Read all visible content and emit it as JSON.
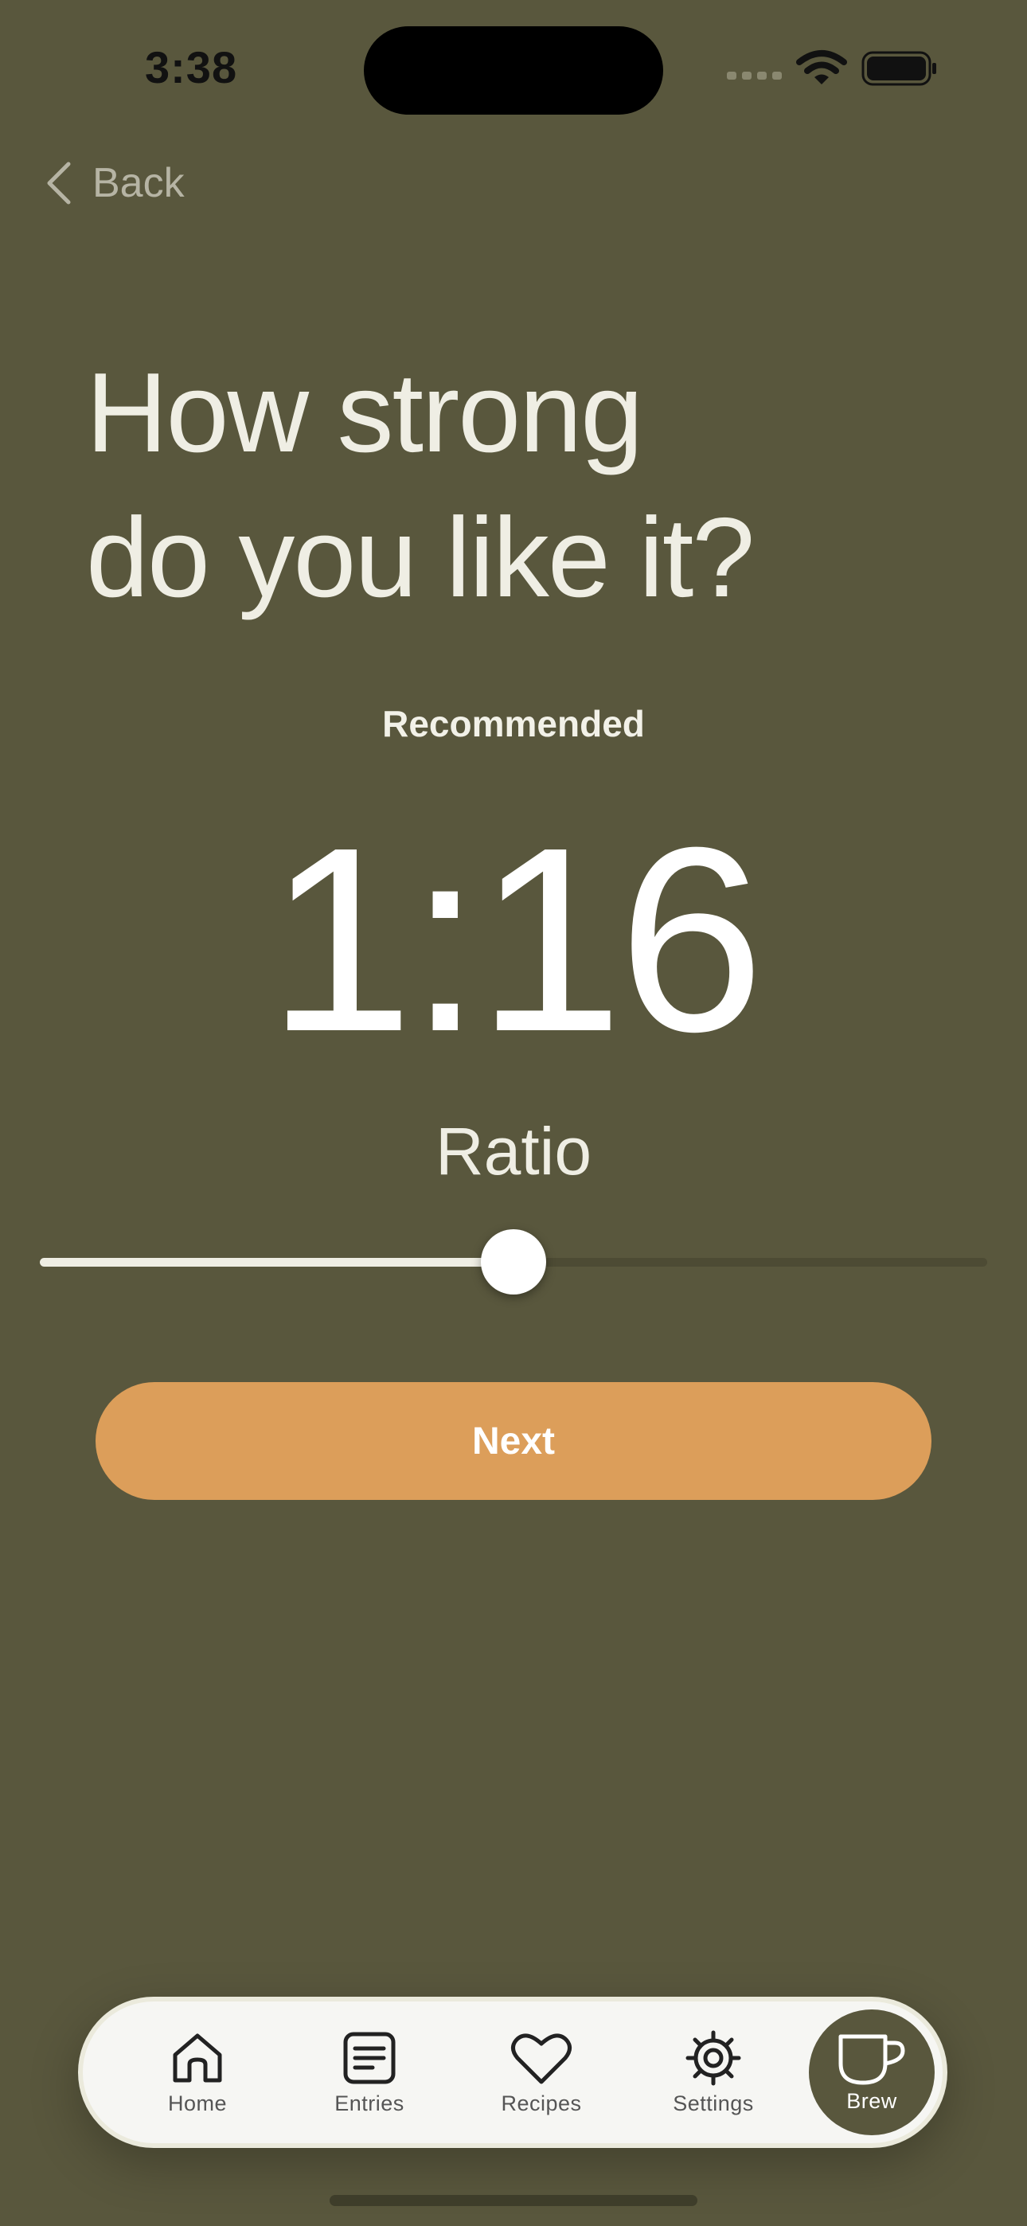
{
  "status_bar": {
    "time": "3:38",
    "icons": [
      "signal-icon",
      "wifi-icon",
      "battery-icon"
    ]
  },
  "nav": {
    "back_label": "Back",
    "back_icon": "chevron-left-icon"
  },
  "headline": {
    "line1": "How strong",
    "line2": "do you like it?"
  },
  "ratio": {
    "badge": "Recommended",
    "value": "1:16",
    "label": "Ratio"
  },
  "slider": {
    "level": 0.5
  },
  "next_button": {
    "label": "Next"
  },
  "tab_bar": {
    "items": [
      {
        "label": "Home",
        "icon": "home-icon"
      },
      {
        "label": "Entries",
        "icon": "entries-icon"
      },
      {
        "label": "Recipes",
        "icon": "heart-icon"
      },
      {
        "label": "Settings",
        "icon": "gear-icon"
      }
    ],
    "brew": {
      "label": "Brew",
      "icon": "cup-icon"
    }
  },
  "colors": {
    "background": "#59573d",
    "accent": "#dc9e5a",
    "text": "#efeee4"
  }
}
